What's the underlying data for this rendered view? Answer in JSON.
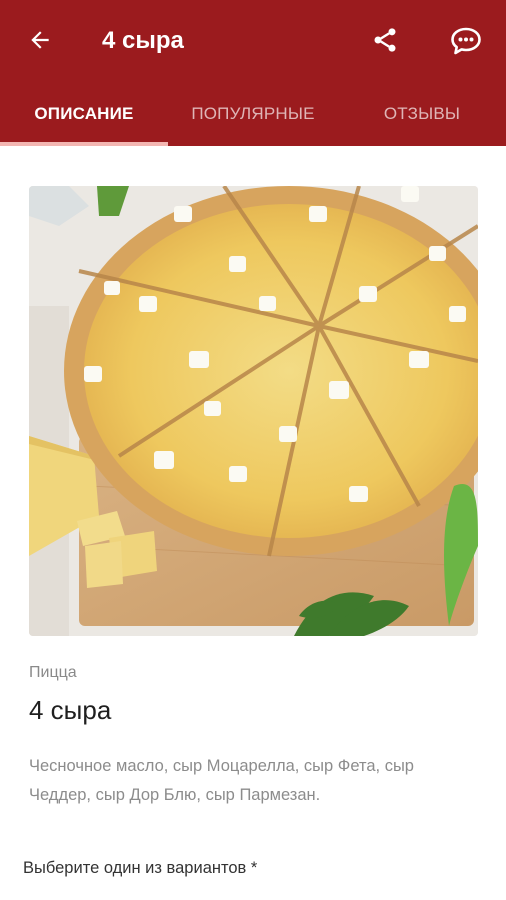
{
  "header": {
    "title": "4 сыра",
    "back_icon": "arrow-back-icon",
    "share_icon": "share-icon",
    "chat_icon": "chat-bubble-icon",
    "background_color": "#9b1b1e"
  },
  "tabs": [
    {
      "label": "ОПИСАНИЕ",
      "active": true
    },
    {
      "label": "ПОПУЛЯРНЫЕ",
      "active": false
    },
    {
      "label": "ОТЗЫВЫ",
      "active": false
    }
  ],
  "product": {
    "category": "Пицца",
    "name": "4 сыра",
    "ingredients": "Чесночное масло, сыр Моцарелла, сыр Фета, сыр Чеддер, сыр Дор Блю, сыр Пармезан."
  },
  "options": {
    "label": "Выберите один из вариантов *"
  }
}
